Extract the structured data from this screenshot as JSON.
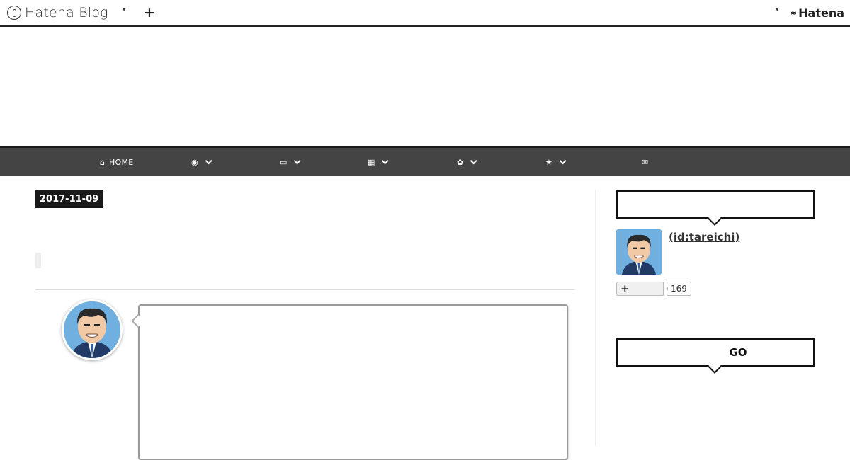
{
  "header": {
    "brand": "Hatena Blog",
    "brand_caret": "▾",
    "add_label": "+",
    "account_caret": "▾",
    "hatena_mark": "≈",
    "hatena_label": "Hatena"
  },
  "nav": {
    "home_label": "HOME",
    "items": [
      {
        "icon": "home-icon",
        "glyph": "⌂"
      },
      {
        "icon": "user-circle-icon",
        "glyph": "◉"
      },
      {
        "icon": "laptop-icon",
        "glyph": "▭"
      },
      {
        "icon": "grid-icon",
        "glyph": "▦"
      },
      {
        "icon": "gear-icon",
        "glyph": "✿"
      },
      {
        "icon": "star-icon",
        "glyph": "★"
      },
      {
        "icon": "envelope-icon",
        "glyph": "✉"
      }
    ]
  },
  "entry": {
    "date": "2017-11-09"
  },
  "sidebar": {
    "profile_heading": "",
    "profile_id": " (id:tareichi)",
    "subscribe_label": "+",
    "subscriber_count": "169",
    "search_heading": "GO"
  },
  "colors": {
    "nav_bg": "#444444",
    "avatar_bg": "#6fb0e0",
    "badge_bg": "#1a1a1a"
  }
}
